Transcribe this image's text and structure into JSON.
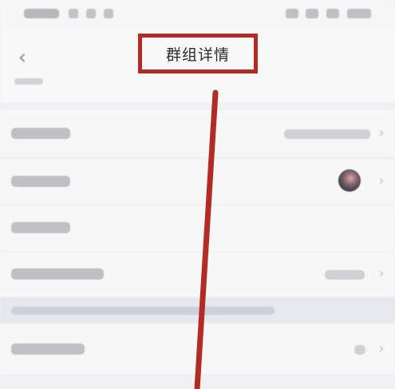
{
  "header": {
    "title": "群组详情",
    "back_icon": "chevron-left-icon"
  },
  "annotation": {
    "highlight_color": "#b42b25"
  }
}
